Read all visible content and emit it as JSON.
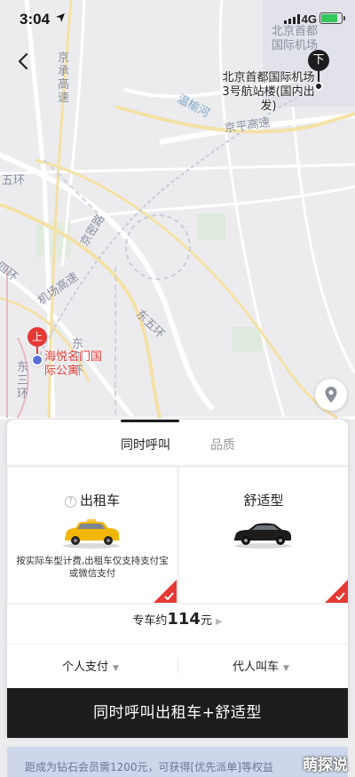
{
  "status_bar": {
    "time": "3:04",
    "network": "4G"
  },
  "map": {
    "airport_area": "北京首都\n国际机场",
    "labels": {
      "jingcheng": "京承高速",
      "wenyu_river": "温榆河",
      "jingping": "京平高速",
      "jingmi": "京密路",
      "fifth_ring": "五环",
      "fourth_ring": "四环",
      "airport_expressway": "机场高速",
      "east_fifth_ring": "东五环",
      "east_fourth_ring": "东四环",
      "east_third_ring": "东三环"
    },
    "destination": {
      "icon_letter": "下",
      "label": "北京首都国际机场3号航站楼(国内出发)"
    },
    "origin": {
      "icon_letter": "上",
      "label": "海悦名门国际公寓"
    }
  },
  "sheet": {
    "tabs": [
      {
        "label": "同时呼叫"
      },
      {
        "label": "品质"
      }
    ],
    "cards": [
      {
        "title": "出租车",
        "help_icon": "?",
        "description": "按实际车型计费,出租车仅支持支付宝或微信支付",
        "car_color": "#f2b705",
        "selected": true
      },
      {
        "title": "舒适型",
        "car_color": "#1c1c1c",
        "selected": true
      }
    ],
    "price": {
      "prefix": "专车约",
      "amount": "114",
      "unit": "元"
    },
    "options": [
      {
        "label": "个人支付"
      },
      {
        "label": "代人叫车"
      }
    ],
    "cta_label": "同时呼叫出租车+舒适型"
  },
  "promo": {
    "text": "距成为钻石会员需1200元，可获得[优先派单]等权益"
  },
  "watermark": "萌探说",
  "colors": {
    "accent_red": "#e53935",
    "dark": "#1d1d1f"
  }
}
